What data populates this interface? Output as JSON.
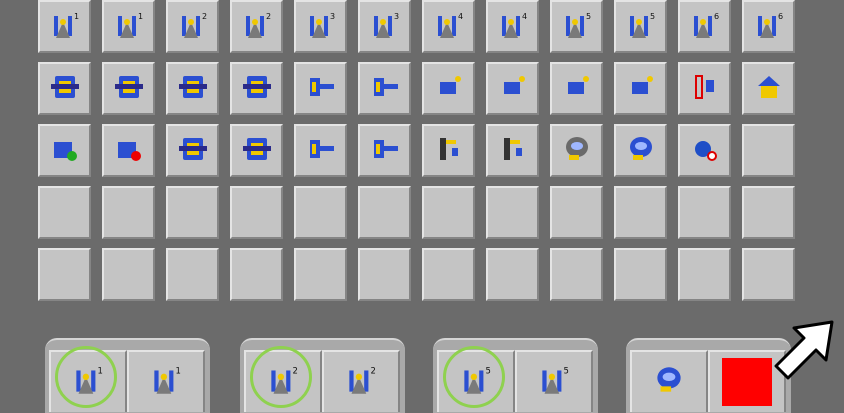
{
  "palette": {
    "background": "#6b6b6b",
    "button_face": "#c4c4c4",
    "icon_blue": "#2b4fd1",
    "icon_yellow": "#f0c800",
    "highlight_ring": "#8fd14f",
    "record_red": "#ff0000"
  },
  "grid_rows": [
    [
      "weld-slot-1-icon",
      "weld-slot-1-alt-icon",
      "weld-slot-2-icon",
      "weld-slot-2-alt-icon",
      "weld-slot-3-icon",
      "weld-slot-3-alt-icon",
      "weld-slot-4-icon",
      "weld-slot-4-alt-icon",
      "weld-slot-5-icon",
      "weld-slot-5-alt-icon",
      "weld-slot-6-icon",
      "weld-slot-6-alt-icon"
    ],
    [
      "insert-right-icon",
      "insert-left-icon",
      "clamp-open-icon",
      "clamp-close-icon",
      "slide-forward-icon",
      "slide-back-icon",
      "sensor-1-icon",
      "sensor-2-icon",
      "camera-1-icon",
      "camera-2-icon",
      "chain-link-icon",
      "station-home-icon"
    ],
    [
      "load-part-icon",
      "reject-part-icon",
      "gripper-open-icon",
      "gripper-close-icon",
      "pin-extend-icon",
      "pin-retract-icon",
      "lift-up-icon",
      "lift-down-icon",
      "rotate-gray-icon",
      "rotate-blue-icon",
      "status-dot-icon",
      "empty-slot"
    ],
    [
      "empty-slot",
      "empty-slot",
      "empty-slot",
      "empty-slot",
      "empty-slot",
      "empty-slot",
      "empty-slot",
      "empty-slot",
      "empty-slot",
      "empty-slot",
      "empty-slot",
      "empty-slot"
    ],
    [
      "empty-slot",
      "empty-slot",
      "empty-slot",
      "empty-slot",
      "empty-slot",
      "empty-slot",
      "empty-slot",
      "empty-slot",
      "empty-slot",
      "empty-slot",
      "empty-slot",
      "empty-slot"
    ]
  ],
  "bottom_groups": [
    {
      "name": "group-1",
      "buttons": [
        "weld-slot-1-icon",
        "weld-slot-1-alt-icon"
      ],
      "highlighted": 0
    },
    {
      "name": "group-2",
      "buttons": [
        "weld-slot-2-icon",
        "weld-slot-2-alt-icon"
      ],
      "highlighted": 0
    },
    {
      "name": "group-3",
      "buttons": [
        "weld-slot-5-icon",
        "weld-slot-5-alt-icon"
      ],
      "highlighted": 0
    },
    {
      "name": "group-4",
      "buttons": [
        "rotate-blue-icon",
        "record-stop-button"
      ],
      "highlighted": -1
    }
  ],
  "pointer": "white-arrow-cursor-icon"
}
